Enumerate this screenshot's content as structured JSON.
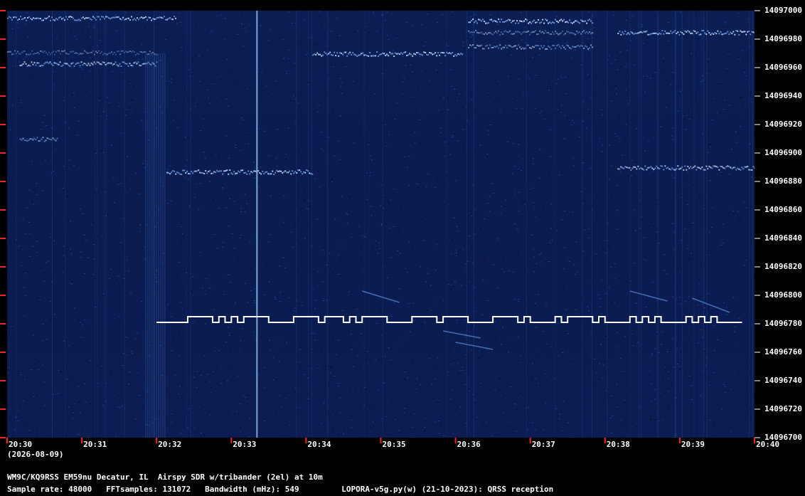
{
  "chart_data": {
    "type": "heatmap",
    "title": "",
    "xlabel": "",
    "ylabel": "",
    "x_ticks": [
      "20:30",
      "20:31",
      "20:32",
      "20:33",
      "20:34",
      "20:35",
      "20:36",
      "20:37",
      "20:38",
      "20:39",
      "20:40"
    ],
    "x_date": "(2026-08-09)",
    "y_ticks": [
      "14097000",
      "14096980",
      "14096960",
      "14096940",
      "14096920",
      "14096900",
      "14096880",
      "14096860",
      "14096840",
      "14096820",
      "14096800",
      "14096780",
      "14096760",
      "14096740",
      "14096720",
      "14096700"
    ],
    "ylim": [
      14096700,
      14097000
    ],
    "xlim": [
      "20:30",
      "20:40"
    ],
    "tick_color": "#ff2020",
    "background_color": "#0b1f55",
    "signal_color": "#ffffff",
    "qrss_signal": {
      "description_freq_low": 14096781,
      "description_freq_high": 14096785,
      "start_time": "20:32",
      "end_time": "20:39:50"
    }
  },
  "footer": {
    "station": "WM9C/KQ9RSS EM59nu Decatur, IL  Airspy SDR w/tribander (2el) at 10m",
    "params": "Sample rate: 48000   FFTsamples: 131072   Bandwidth (mHz): 549         LOPORA-v5g.py(w) (21-10-2023): QRSS reception"
  }
}
